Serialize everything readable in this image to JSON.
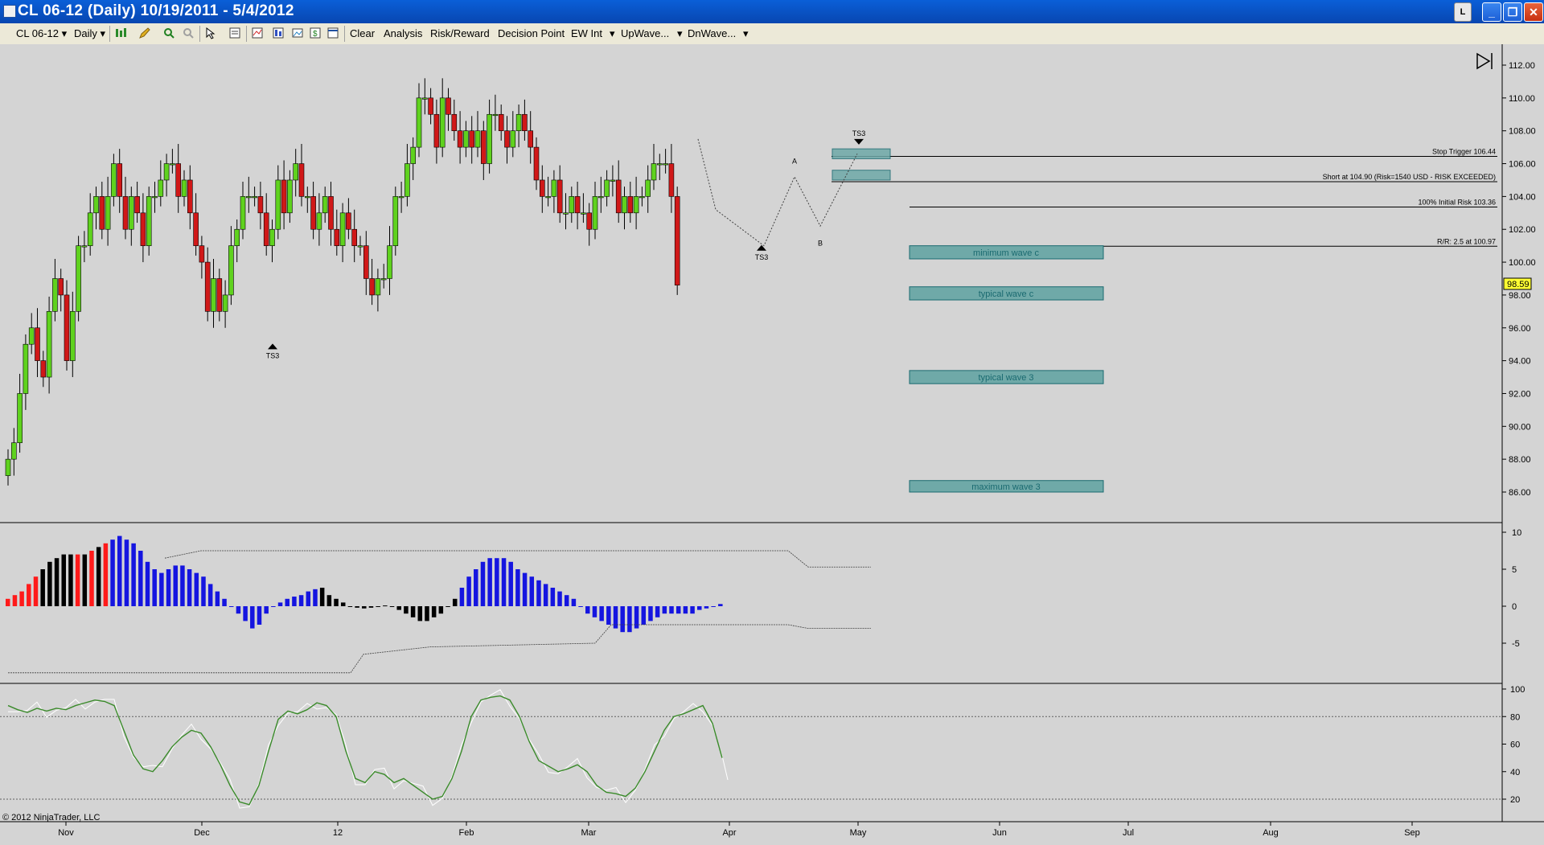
{
  "window": {
    "title": "CL 06-12 (Daily)  10/19/2011 - 5/4/2012",
    "controls": {
      "layout": "L",
      "minimize": "_",
      "restore": "❐",
      "close": "✕"
    }
  },
  "toolbar": {
    "instrument": "CL 06-12",
    "period": "Daily",
    "items": [
      "Clear",
      "Analysis",
      "Risk/Reward",
      "Decision Point",
      "EW Int",
      "UpWave...",
      "DnWave..."
    ]
  },
  "price_panel": {
    "axis_ticks": [
      "112.00",
      "110.00",
      "108.00",
      "106.00",
      "104.00",
      "102.00",
      "100.00",
      "98.00",
      "96.00",
      "94.00",
      "92.00",
      "90.00",
      "88.00",
      "86.00"
    ],
    "last_price": "98.59",
    "lines": [
      {
        "label": "Stop Trigger 106.44",
        "price": 106.44
      },
      {
        "label": "Short at 104.90 (Risk=1540 USD - RISK EXCEEDED)",
        "price": 104.9
      },
      {
        "label": "100% Initial Risk 103.36",
        "price": 103.36
      },
      {
        "label": "R/R: 2.5 at 100.97",
        "price": 100.97
      }
    ],
    "zones": [
      {
        "label": "minimum wave c",
        "top": 101.0,
        "bottom": 100.2
      },
      {
        "label": "typical wave c",
        "top": 98.5,
        "bottom": 97.7
      },
      {
        "label": "typical wave 3",
        "top": 93.4,
        "bottom": 92.6
      },
      {
        "label": "maximum wave 3",
        "top": 86.7,
        "bottom": 86.0
      }
    ],
    "markers": [
      "TS3",
      "TS3",
      "TS3",
      "A",
      "B"
    ]
  },
  "oscillator_panel": {
    "axis_ticks": [
      "10",
      "5",
      "0",
      "-5"
    ]
  },
  "stochastic_panel": {
    "axis_ticks": [
      "100",
      "80",
      "60",
      "40",
      "20"
    ]
  },
  "x_axis": {
    "labels": [
      "Nov",
      "Dec",
      "12",
      "Feb",
      "Mar",
      "Apr",
      "May",
      "Jun",
      "Jul",
      "Aug",
      "Sep"
    ]
  },
  "copyright": "© 2012 NinjaTrader, LLC",
  "colors": {
    "up_candle": "#5fd21e",
    "down_candle": "#d01818",
    "zone_fill": "#6fa9a8",
    "zone_text": "#1a6a70",
    "histogram_blue": "#1515e0",
    "histogram_black": "#000000",
    "histogram_red": "#ff1a1a",
    "stoch_green": "#3a8a2a"
  }
}
